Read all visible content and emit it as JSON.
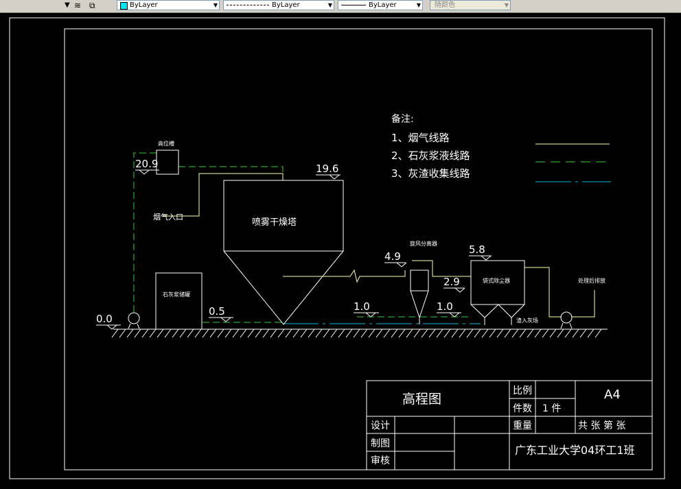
{
  "toolbar": {
    "color_combo": "ByLayer",
    "linetype_combo": "ByLayer",
    "lineweight_combo": "ByLayer",
    "plotstyle_combo": "随颜色",
    "color_swatch": "#00e5ee"
  },
  "drawing": {
    "notes": {
      "title": "备注:",
      "items": [
        "1、烟气线路",
        "2、石灰浆液线路",
        "3、灰渣收集线路"
      ]
    },
    "labels": {
      "high_tank": "高位槽",
      "flue_inlet": "烟气入口",
      "spray_tower": "喷雾干燥塔",
      "lime_tank": "石灰浆储罐",
      "cyclone": "旋风分离器",
      "bag_filter": "袋式除尘器",
      "process_tank": "处理后排放",
      "ash_outlet": "渣入灰场"
    },
    "elevations": {
      "e209": "20.9",
      "e196": "19.6",
      "e49": "4.9",
      "e58": "5.8",
      "e29": "2.9",
      "e10a": "1.0",
      "e10b": "1.0",
      "e05": "0.5",
      "e00": "0.0"
    },
    "colors": {
      "flue_line": "#ffffaa",
      "lime_line": "#33cc33",
      "ash_line": "#00bbdd",
      "frame": "#ffffff"
    }
  },
  "title_block": {
    "drawing_name": "高程图",
    "scale_label": "比例",
    "quantity_label": "件数",
    "quantity_value": "1 件",
    "weight_label": "重量",
    "paper_size": "A4",
    "sheet_info": "共 张 第 张",
    "design_label": "设计",
    "draft_label": "制图",
    "review_label": "审核",
    "organization": "广东工业大学04环工1班"
  }
}
